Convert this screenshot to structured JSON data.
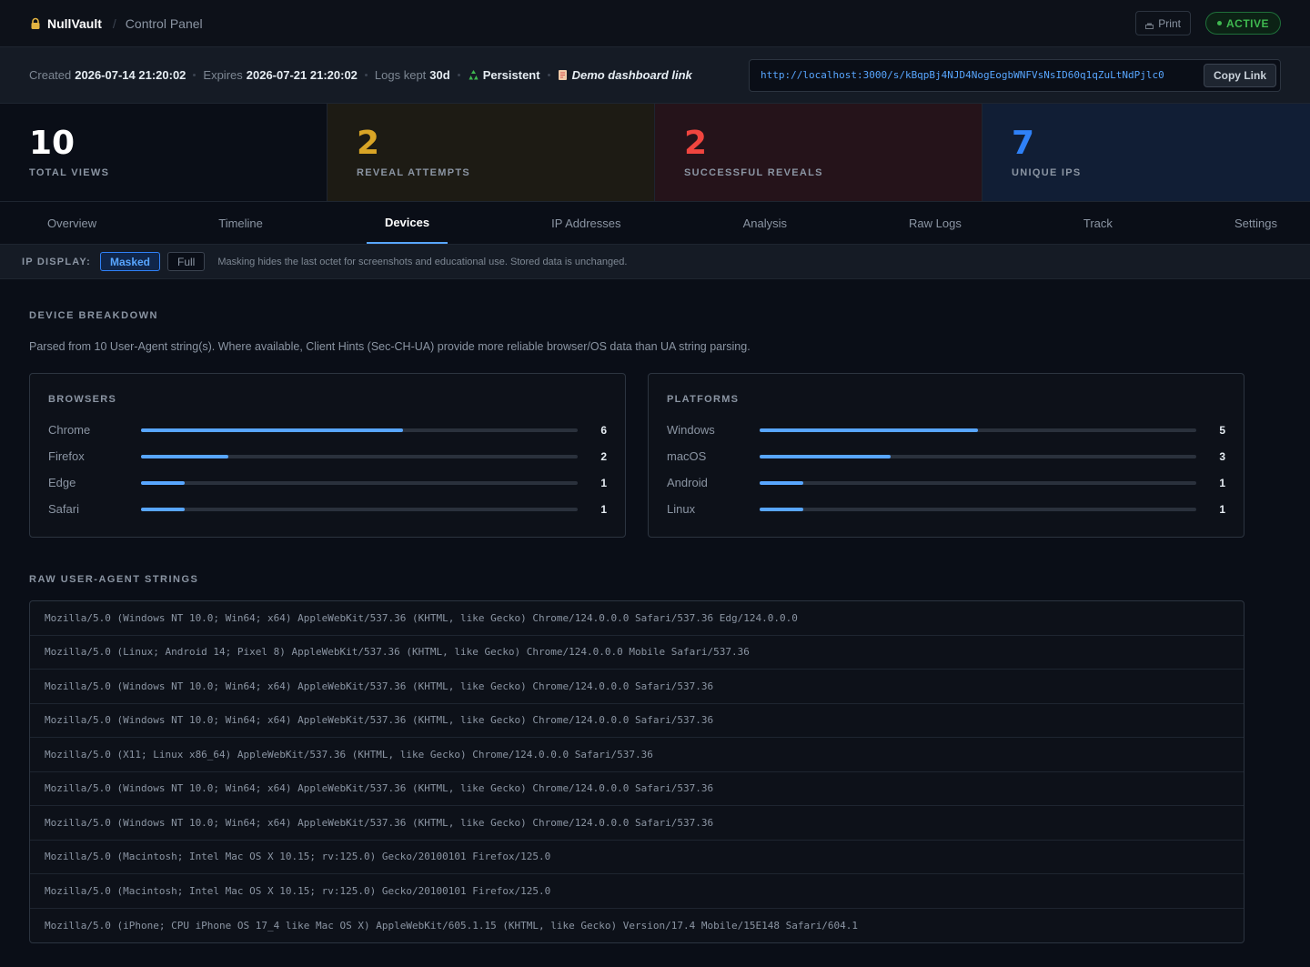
{
  "header": {
    "brand": "NullVault",
    "crumb": "Control Panel",
    "print_label": "Print",
    "status": "ACTIVE"
  },
  "info": {
    "created_label": "Created",
    "created_value": "2026-07-14 21:20:02",
    "expires_label": "Expires",
    "expires_value": "2026-07-21 21:20:02",
    "logs_label": "Logs kept",
    "logs_value": "30d",
    "persistent": "Persistent",
    "demo_link": "Demo dashboard link",
    "url": "http://localhost:3000/s/kBqpBj4NJD4NogEogbWNFVsNsID60q1qZuLtNdPjlc0",
    "copy_label": "Copy Link"
  },
  "stats": [
    {
      "value": "10",
      "label": "TOTAL VIEWS"
    },
    {
      "value": "2",
      "label": "REVEAL ATTEMPTS"
    },
    {
      "value": "2",
      "label": "SUCCESSFUL REVEALS"
    },
    {
      "value": "7",
      "label": "UNIQUE IPS"
    }
  ],
  "tabs": [
    "Overview",
    "Timeline",
    "Devices",
    "IP Addresses",
    "Analysis",
    "Raw Logs",
    "Track",
    "Settings"
  ],
  "active_tab": "Devices",
  "ip_display": {
    "label": "IP DISPLAY:",
    "masked": "Masked",
    "full": "Full",
    "note": "Masking hides the last octet for screenshots and educational use. Stored data is unchanged."
  },
  "device_breakdown": {
    "title": "DEVICE BREAKDOWN",
    "description": "Parsed from 10 User-Agent string(s). Where available, Client Hints (Sec-CH-UA) provide more reliable browser/OS data than UA string parsing.",
    "browsers": {
      "title": "BROWSERS",
      "max": 10,
      "items": [
        {
          "name": "Chrome",
          "count": 6
        },
        {
          "name": "Firefox",
          "count": 2
        },
        {
          "name": "Edge",
          "count": 1
        },
        {
          "name": "Safari",
          "count": 1
        }
      ]
    },
    "platforms": {
      "title": "PLATFORMS",
      "max": 10,
      "items": [
        {
          "name": "Windows",
          "count": 5
        },
        {
          "name": "macOS",
          "count": 3
        },
        {
          "name": "Android",
          "count": 1
        },
        {
          "name": "Linux",
          "count": 1
        }
      ]
    }
  },
  "raw_ua": {
    "title": "RAW USER-AGENT STRINGS",
    "items": [
      "Mozilla/5.0 (Windows NT 10.0; Win64; x64) AppleWebKit/537.36 (KHTML, like Gecko) Chrome/124.0.0.0 Safari/537.36 Edg/124.0.0.0",
      "Mozilla/5.0 (Linux; Android 14; Pixel 8) AppleWebKit/537.36 (KHTML, like Gecko) Chrome/124.0.0.0 Mobile Safari/537.36",
      "Mozilla/5.0 (Windows NT 10.0; Win64; x64) AppleWebKit/537.36 (KHTML, like Gecko) Chrome/124.0.0.0 Safari/537.36",
      "Mozilla/5.0 (Windows NT 10.0; Win64; x64) AppleWebKit/537.36 (KHTML, like Gecko) Chrome/124.0.0.0 Safari/537.36",
      "Mozilla/5.0 (X11; Linux x86_64) AppleWebKit/537.36 (KHTML, like Gecko) Chrome/124.0.0.0 Safari/537.36",
      "Mozilla/5.0 (Windows NT 10.0; Win64; x64) AppleWebKit/537.36 (KHTML, like Gecko) Chrome/124.0.0.0 Safari/537.36",
      "Mozilla/5.0 (Windows NT 10.0; Win64; x64) AppleWebKit/537.36 (KHTML, like Gecko) Chrome/124.0.0.0 Safari/537.36",
      "Mozilla/5.0 (Macintosh; Intel Mac OS X 10.15; rv:125.0) Gecko/20100101 Firefox/125.0",
      "Mozilla/5.0 (Macintosh; Intel Mac OS X 10.15; rv:125.0) Gecko/20100101 Firefox/125.0",
      "Mozilla/5.0 (iPhone; CPU iPhone OS 17_4 like Mac OS X) AppleWebKit/605.1.15 (KHTML, like Gecko) Version/17.4 Mobile/15E148 Safari/604.1"
    ]
  },
  "colors": {
    "accent": "#58a6ff",
    "active_green": "#3fb950",
    "reveal_attempts": "#d9a526",
    "successful_reveals": "#f0453f",
    "unique_ips": "#2f81f7"
  },
  "icons": {
    "brand": "lock-icon",
    "print": "printer-icon",
    "persistent": "recycle-icon",
    "demo": "document-icon"
  }
}
